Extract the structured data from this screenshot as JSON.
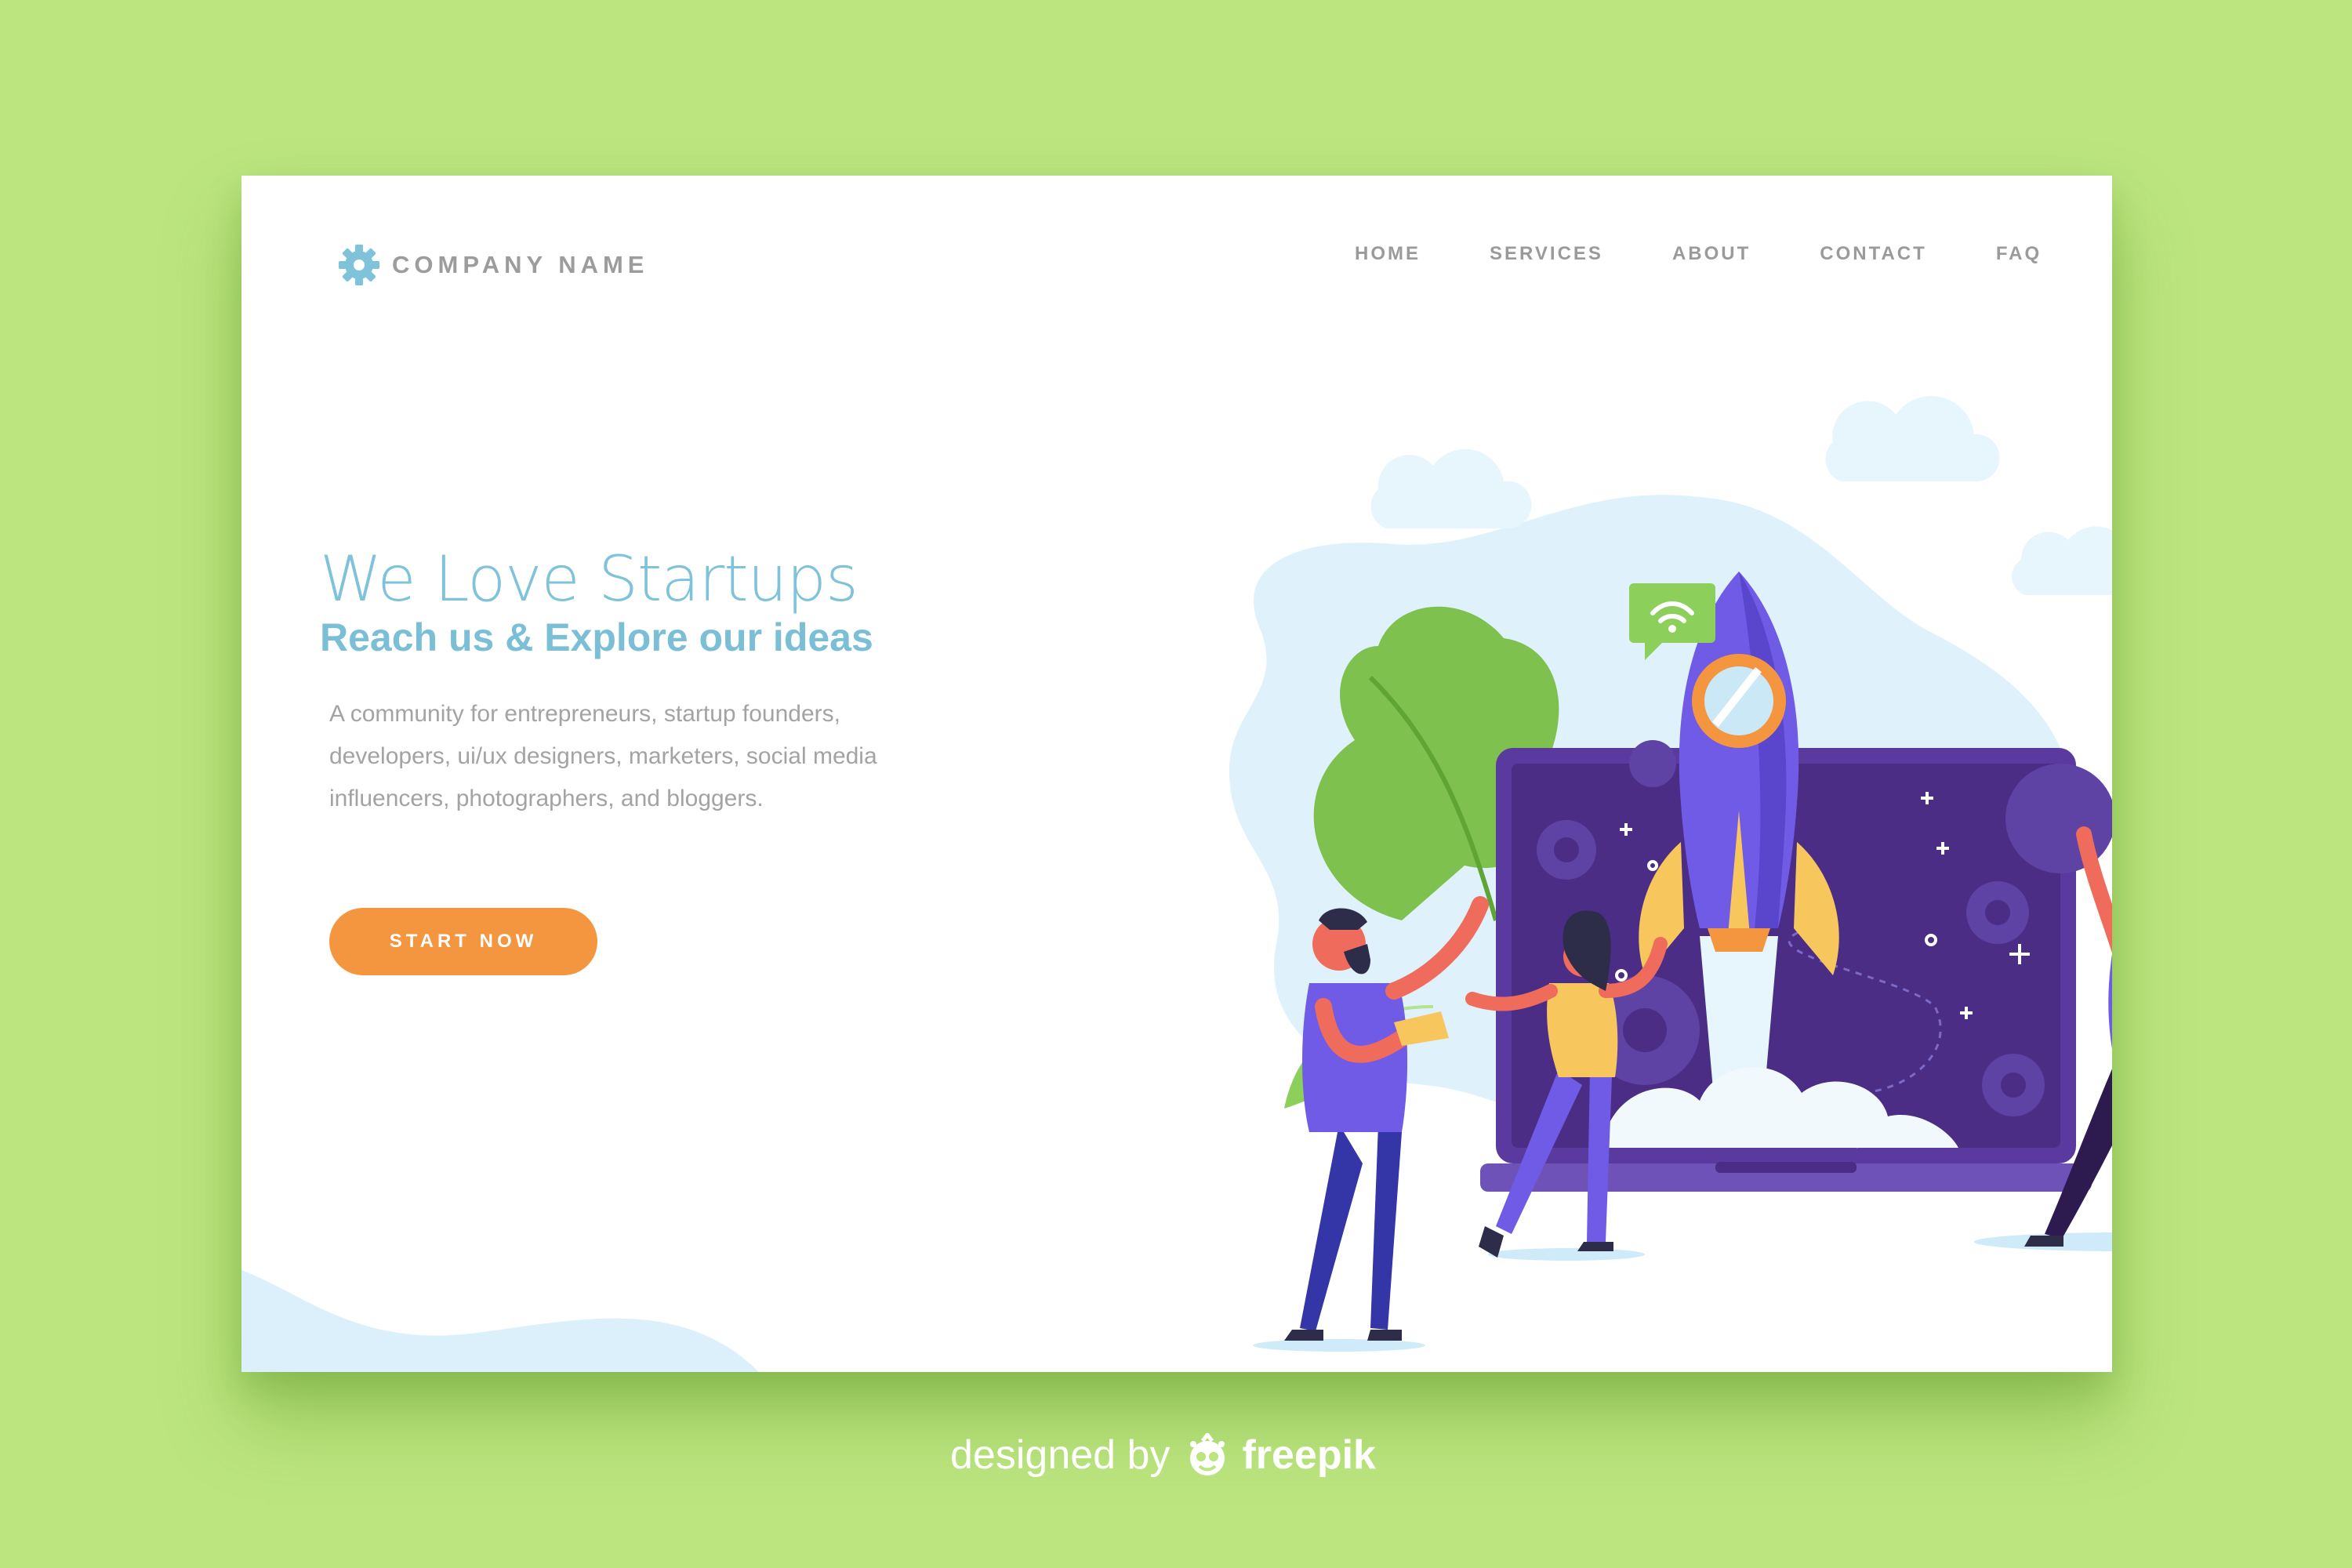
{
  "brand": {
    "name": "COMPANY NAME",
    "icon": "gear-icon"
  },
  "nav": {
    "items": [
      "HOME",
      "SERVICES",
      "ABOUT",
      "CONTACT",
      "FAQ"
    ]
  },
  "hero": {
    "title": "We Love Startups",
    "subtitle": "Reach us & Explore our ideas",
    "description": "A community for entrepreneurs, startup founders, developers, ui/ux designers, marketers, social media influencers, photographers, and bloggers.",
    "cta": "START NOW"
  },
  "illustration": {
    "subject": "rocket launching from laptop screen with three people celebrating",
    "icons": [
      "rocket-icon",
      "wifi-icon",
      "gear-icon",
      "cloud-icon",
      "leaf-icon"
    ]
  },
  "footer_credit": {
    "prefix": "designed by",
    "brand": "freepik"
  },
  "colors": {
    "page_background": "#bce57f",
    "card_background": "#ffffff",
    "accent_blue": "#7ec3d9",
    "cta_orange": "#f4963f",
    "laptop_purple": "#4b2d86",
    "rocket_purple": "#6f5be6",
    "leaf_green": "#78c04a",
    "nav_gray": "#9a9a9a"
  }
}
